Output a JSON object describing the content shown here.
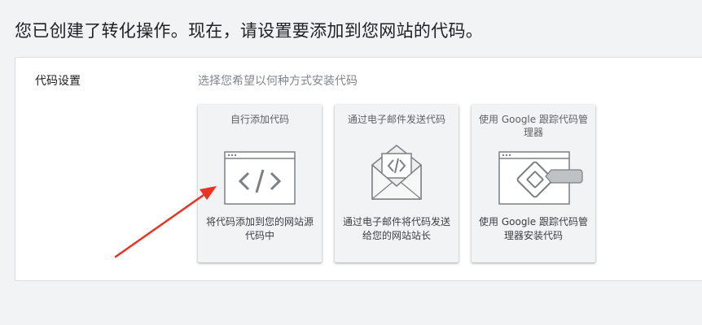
{
  "page": {
    "heading": "您已创建了转化操作。现在，请设置要添加到您网站的代码。"
  },
  "code_settings": {
    "label": "代码设置",
    "hint": "选择您希望以何种方式安装代码"
  },
  "options": [
    {
      "title": "自行添加代码",
      "description": "将代码添加到您的网站源代码中",
      "icon": "browser-code-icon"
    },
    {
      "title": "通过电子邮件发送代码",
      "description": "通过电子邮件将代码发送给您的网站站长",
      "icon": "envelope-code-icon"
    },
    {
      "title": "使用 Google 跟踪代码管理器",
      "description": "使用 Google 跟踪代码管理器安装代码",
      "icon": "tag-manager-icon"
    }
  ],
  "colors": {
    "card_background": "#f1f3f4",
    "illustration_stroke": "#7c8082",
    "annotation_arrow": "#ea3323"
  }
}
